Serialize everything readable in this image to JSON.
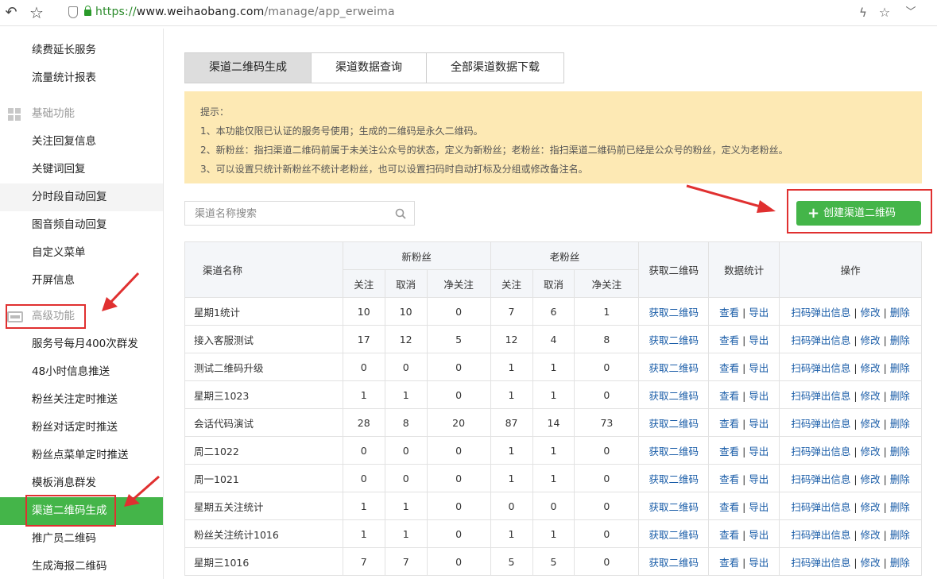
{
  "browser": {
    "url_proto": "https://",
    "url_domain": "www.weihaobang.com",
    "url_path": "/manage/app_erweima"
  },
  "sidebar": {
    "items_top": [
      "续费延长服务",
      "流量统计报表"
    ],
    "section_basic": "基础功能",
    "items_basic": [
      "关注回复信息",
      "关键词回复",
      "分时段自动回复",
      "图音频自动回复",
      "自定义菜单",
      "开屏信息"
    ],
    "section_advanced": "高级功能",
    "items_advanced": [
      "服务号每月400次群发",
      "48小时信息推送",
      "粉丝关注定时推送",
      "粉丝对话定时推送",
      "粉丝点菜单定时推送",
      "模板消息群发",
      "渠道二维码生成",
      "推广员二维码",
      "生成海报二维码"
    ]
  },
  "tabs": [
    "渠道二维码生成",
    "渠道数据查询",
    "全部渠道数据下载"
  ],
  "notice": {
    "title": "提示：",
    "lines": [
      "1、本功能仅限已认证的服务号使用；生成的二维码是永久二维码。",
      "2、新粉丝：指扫渠道二维码前属于未关注公众号的状态，定义为新粉丝；老粉丝：指扫渠道二维码前已经是公众号的粉丝，定义为老粉丝。",
      "3、可以设置只统计新粉丝不统计老粉丝，也可以设置扫码时自动打标及分组或修改备注名。"
    ]
  },
  "search": {
    "placeholder": "渠道名称搜索"
  },
  "create_button": "创建渠道二维码",
  "table": {
    "headers": {
      "name": "渠道名称",
      "new_fans": "新粉丝",
      "old_fans": "老粉丝",
      "follow": "关注",
      "cancel": "取消",
      "net": "净关注",
      "get_qr": "获取二维码",
      "stats": "数据统计",
      "ops": "操作"
    },
    "link_labels": {
      "get_qr": "获取二维码",
      "view": "查看",
      "export": "导出",
      "popup": "扫码弹出信息",
      "edit": "修改",
      "delete": "删除",
      "sep": "|"
    },
    "rows": [
      [
        "星期1统计",
        "10",
        "10",
        "0",
        "7",
        "6",
        "1"
      ],
      [
        "接入客服测试",
        "17",
        "12",
        "5",
        "12",
        "4",
        "8"
      ],
      [
        "测试二维码升级",
        "0",
        "0",
        "0",
        "1",
        "1",
        "0"
      ],
      [
        "星期三1023",
        "1",
        "1",
        "0",
        "1",
        "1",
        "0"
      ],
      [
        "会话代码演试",
        "28",
        "8",
        "20",
        "87",
        "14",
        "73"
      ],
      [
        "周二1022",
        "0",
        "0",
        "0",
        "1",
        "1",
        "0"
      ],
      [
        "周一1021",
        "0",
        "0",
        "0",
        "1",
        "1",
        "0"
      ],
      [
        "星期五关注统计",
        "1",
        "1",
        "0",
        "0",
        "0",
        "0"
      ],
      [
        "粉丝关注统计1016",
        "1",
        "1",
        "0",
        "1",
        "1",
        "0"
      ],
      [
        "星期三1016",
        "7",
        "7",
        "0",
        "5",
        "5",
        "0"
      ]
    ]
  },
  "colors": {
    "accent_green": "#44b549",
    "highlight_red": "#e03030",
    "notice_bg": "#fde9b4",
    "link_blue": "#1a5da8"
  }
}
